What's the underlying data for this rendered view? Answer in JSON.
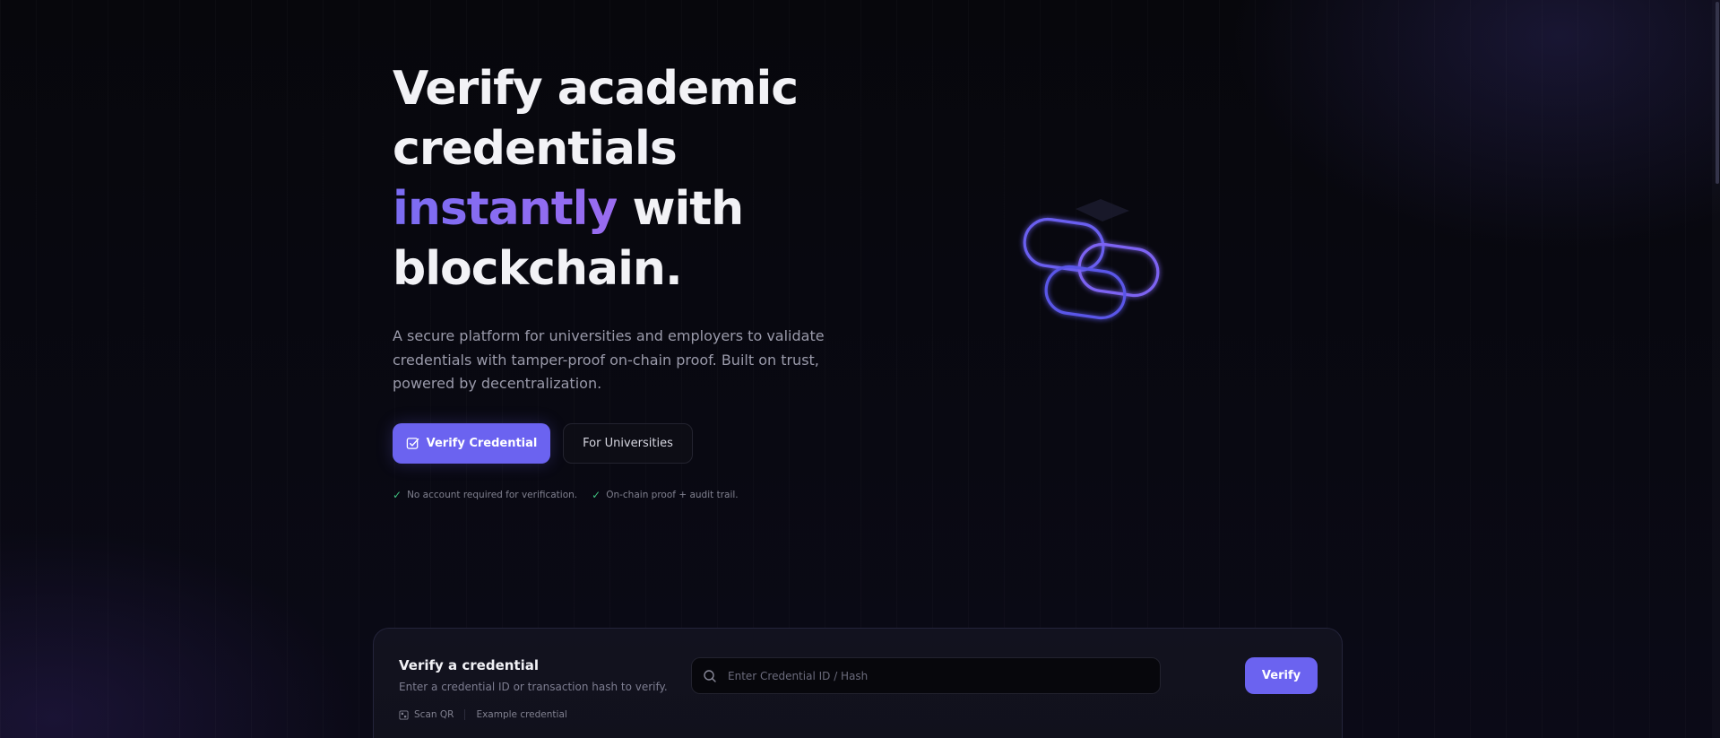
{
  "hero": {
    "title_line1": "Verify academic credentials",
    "title_accent": "instantly",
    "title_rest": " with blockchain.",
    "subtitle": "A secure platform for universities and employers to validate credentials with tamper-proof on-chain proof. Built on trust, powered by decentralization.",
    "primary_button": "Verify Credential",
    "secondary_button": "For Universities",
    "assurances": [
      "No account required for verification.",
      "On-chain proof + audit trail."
    ]
  },
  "verify_card": {
    "title": "Verify a credential",
    "description": "Enter a credential ID or transaction hash to verify.",
    "search_placeholder": "Enter Credential ID / Hash",
    "search_value": "",
    "verify_button": "Verify",
    "links": {
      "scan_qr": "Scan QR",
      "example": "Example credential"
    }
  },
  "colors": {
    "accent": "#6b63f0",
    "accent_text": "#7a6cf2",
    "check": "#3fbf7f",
    "background": "#07070d"
  },
  "icons": [
    "check-square-icon",
    "check-icon",
    "search-icon",
    "qr-icon",
    "chain-link-icon",
    "graduation-cap-icon"
  ]
}
